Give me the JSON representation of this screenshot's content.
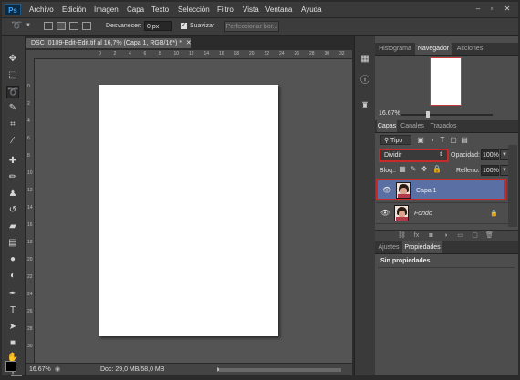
{
  "app": {
    "logo": "Ps"
  },
  "menu": [
    "Archivo",
    "Edición",
    "Imagen",
    "Capa",
    "Texto",
    "Selección",
    "Filtro",
    "Vista",
    "Ventana",
    "Ayuda"
  ],
  "window_controls": {
    "minimize": "–",
    "restore": "▫",
    "close": "✕"
  },
  "options": {
    "feather_label": "Desvanecer:",
    "feather_value": "0 px",
    "smooth_label": "Suavizar",
    "smooth_checked": true,
    "refine_button": "Perfeccionar bor..."
  },
  "document": {
    "tab_title": "DSC_0109-Edit-Edit.tif al 16,7% (Capa 1, RGB/16*) *",
    "close_glyph": "✕",
    "ruler_top": [
      "0",
      "2",
      "4",
      "6",
      "8",
      "10",
      "12",
      "14",
      "16",
      "18",
      "20",
      "22",
      "24",
      "26",
      "28",
      "30",
      "32",
      "34"
    ],
    "ruler_left": [
      "0",
      "2",
      "4",
      "6",
      "8",
      "10",
      "12",
      "14",
      "16",
      "18",
      "20",
      "22",
      "24",
      "26",
      "28",
      "30",
      "32",
      "34"
    ]
  },
  "status": {
    "zoom": "16.67%",
    "doc_size": "Doc: 29,0 MB/58,0 MB"
  },
  "tools": [
    "move-tool",
    "marquee-tool",
    "lasso-tool",
    "quick-select-tool",
    "crop-tool",
    "eyedropper-tool",
    "healing-tool",
    "brush-tool",
    "stamp-tool",
    "history-brush-tool",
    "eraser-tool",
    "gradient-tool",
    "blur-tool",
    "dodge-tool",
    "pen-tool",
    "type-tool",
    "path-select-tool",
    "shape-tool",
    "hand-tool",
    "zoom-tool"
  ],
  "navigator_panel": {
    "tabs": [
      "Histograma",
      "Navegador",
      "Acciones"
    ],
    "active_tab": "Navegador",
    "zoom": "16.67%"
  },
  "layers_panel": {
    "tabs": [
      "Capas",
      "Canales",
      "Trazados"
    ],
    "active_tab": "Capas",
    "filter_kind": "Tipo",
    "blend_mode": "Dividir",
    "opacity_label": "Opacidad:",
    "opacity_value": "100%",
    "lock_label": "Bloq.:",
    "fill_label": "Relleno:",
    "fill_value": "100%",
    "layers": [
      {
        "name": "Capa 1",
        "selected": true,
        "visible": true,
        "locked": false
      },
      {
        "name": "Fondo",
        "selected": false,
        "visible": true,
        "locked": true
      }
    ]
  },
  "properties_panel": {
    "tabs": [
      "Ajustes",
      "Propiedades"
    ],
    "active_tab": "Propiedades",
    "title": "Sin propiedades"
  },
  "colors": {
    "accent_red": "#c82a2a",
    "selected_layer": "#5a6fa3",
    "canvas_bg": "#545454"
  }
}
